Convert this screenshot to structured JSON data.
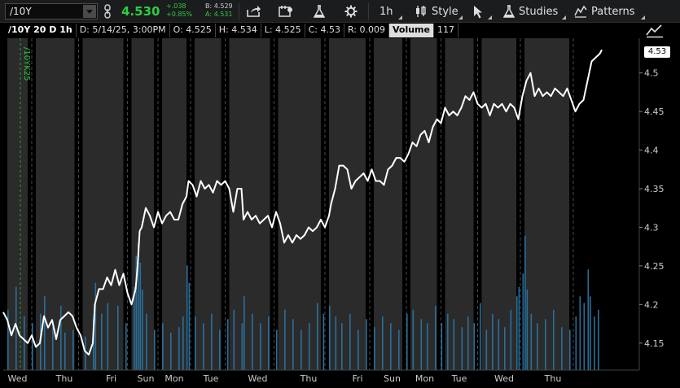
{
  "toolbar": {
    "symbol": "/10Y",
    "last_price": "4.530",
    "net_change": "+.038",
    "net_change_pct": "+0.85%",
    "bid": "B: 4.529",
    "ask": "A: 4.531",
    "timeframe": "1h",
    "style_label": "Style",
    "studies_label": "Studies",
    "patterns_label": "Patterns"
  },
  "info_bar": {
    "title": "/10Y 20 D 1h",
    "date": "D: 5/14/25, 3:00PM",
    "open": "O: 4.525",
    "high": "H: 4.534",
    "low": "L: 4.525",
    "close": "C: 4.53",
    "range": "R: 0.009",
    "volume_label": "Volume",
    "volume_value": "117"
  },
  "price_tag": "4.53",
  "contract_label": "/10YK25",
  "colors": {
    "line": "#ffffff",
    "volume": "#2a6f9a",
    "up": "#2ecc40",
    "session_bg": "#3a3a3a"
  },
  "chart_data": {
    "type": "line",
    "ylim": [
      4.115,
      4.545
    ],
    "y_ticks": [
      4.15,
      4.2,
      4.25,
      4.3,
      4.35,
      4.4,
      4.45,
      4.5
    ],
    "x_tick_labels": [
      "Wed",
      "Thu",
      "Fri",
      "Sun",
      "Mon",
      "Tue",
      "Wed",
      "Thu",
      "Fri",
      "Sun",
      "Mon",
      "Tue",
      "Wed",
      "Thu"
    ],
    "x_tick_positions": [
      7,
      30,
      53,
      70,
      84,
      102,
      125,
      150,
      174,
      191,
      207,
      224,
      246,
      270
    ],
    "bar_count": 285,
    "price": [
      [
        0,
        4.19
      ],
      [
        2,
        4.18
      ],
      [
        4,
        4.16
      ],
      [
        6,
        4.175
      ],
      [
        8,
        4.16
      ],
      [
        10,
        4.155
      ],
      [
        12,
        4.15
      ],
      [
        14,
        4.16
      ],
      [
        16,
        4.145
      ],
      [
        18,
        4.15
      ],
      [
        20,
        4.185
      ],
      [
        22,
        4.17
      ],
      [
        24,
        4.18
      ],
      [
        26,
        4.155
      ],
      [
        28,
        4.18
      ],
      [
        30,
        4.185
      ],
      [
        32,
        4.19
      ],
      [
        34,
        4.185
      ],
      [
        36,
        4.17
      ],
      [
        38,
        4.16
      ],
      [
        40,
        4.14
      ],
      [
        42,
        4.135
      ],
      [
        44,
        4.15
      ],
      [
        45,
        4.2
      ],
      [
        47,
        4.22
      ],
      [
        49,
        4.22
      ],
      [
        51,
        4.235
      ],
      [
        53,
        4.225
      ],
      [
        55,
        4.245
      ],
      [
        57,
        4.225
      ],
      [
        59,
        4.24
      ],
      [
        61,
        4.215
      ],
      [
        63,
        4.2
      ],
      [
        65,
        4.22
      ],
      [
        66,
        4.25
      ],
      [
        67,
        4.295
      ],
      [
        68,
        4.3
      ],
      [
        70,
        4.325
      ],
      [
        72,
        4.315
      ],
      [
        74,
        4.3
      ],
      [
        76,
        4.32
      ],
      [
        78,
        4.305
      ],
      [
        80,
        4.315
      ],
      [
        82,
        4.32
      ],
      [
        84,
        4.31
      ],
      [
        86,
        4.31
      ],
      [
        88,
        4.33
      ],
      [
        90,
        4.34
      ],
      [
        91,
        4.36
      ],
      [
        93,
        4.355
      ],
      [
        95,
        4.34
      ],
      [
        97,
        4.36
      ],
      [
        99,
        4.35
      ],
      [
        101,
        4.355
      ],
      [
        103,
        4.345
      ],
      [
        105,
        4.36
      ],
      [
        107,
        4.355
      ],
      [
        109,
        4.36
      ],
      [
        111,
        4.35
      ],
      [
        113,
        4.32
      ],
      [
        115,
        4.35
      ],
      [
        117,
        4.35
      ],
      [
        118,
        4.31
      ],
      [
        120,
        4.32
      ],
      [
        122,
        4.31
      ],
      [
        124,
        4.315
      ],
      [
        126,
        4.305
      ],
      [
        128,
        4.31
      ],
      [
        130,
        4.315
      ],
      [
        132,
        4.3
      ],
      [
        134,
        4.32
      ],
      [
        136,
        4.305
      ],
      [
        138,
        4.28
      ],
      [
        140,
        4.29
      ],
      [
        142,
        4.28
      ],
      [
        144,
        4.29
      ],
      [
        146,
        4.285
      ],
      [
        148,
        4.29
      ],
      [
        150,
        4.3
      ],
      [
        152,
        4.295
      ],
      [
        154,
        4.3
      ],
      [
        156,
        4.31
      ],
      [
        158,
        4.3
      ],
      [
        160,
        4.315
      ],
      [
        161,
        4.33
      ],
      [
        163,
        4.35
      ],
      [
        165,
        4.38
      ],
      [
        167,
        4.38
      ],
      [
        169,
        4.375
      ],
      [
        171,
        4.35
      ],
      [
        173,
        4.36
      ],
      [
        175,
        4.365
      ],
      [
        177,
        4.37
      ],
      [
        179,
        4.36
      ],
      [
        181,
        4.375
      ],
      [
        183,
        4.36
      ],
      [
        185,
        4.36
      ],
      [
        187,
        4.355
      ],
      [
        189,
        4.375
      ],
      [
        191,
        4.38
      ],
      [
        193,
        4.39
      ],
      [
        195,
        4.39
      ],
      [
        197,
        4.385
      ],
      [
        199,
        4.395
      ],
      [
        201,
        4.41
      ],
      [
        203,
        4.405
      ],
      [
        205,
        4.42
      ],
      [
        207,
        4.425
      ],
      [
        209,
        4.41
      ],
      [
        211,
        4.43
      ],
      [
        213,
        4.44
      ],
      [
        215,
        4.435
      ],
      [
        217,
        4.455
      ],
      [
        219,
        4.445
      ],
      [
        221,
        4.45
      ],
      [
        223,
        4.445
      ],
      [
        225,
        4.455
      ],
      [
        227,
        4.47
      ],
      [
        229,
        4.465
      ],
      [
        231,
        4.475
      ],
      [
        233,
        4.46
      ],
      [
        235,
        4.455
      ],
      [
        237,
        4.46
      ],
      [
        239,
        4.445
      ],
      [
        241,
        4.46
      ],
      [
        243,
        4.455
      ],
      [
        245,
        4.46
      ],
      [
        247,
        4.45
      ],
      [
        249,
        4.46
      ],
      [
        251,
        4.455
      ],
      [
        253,
        4.44
      ],
      [
        255,
        4.47
      ],
      [
        257,
        4.49
      ],
      [
        259,
        4.5
      ],
      [
        261,
        4.47
      ],
      [
        263,
        4.48
      ],
      [
        265,
        4.47
      ],
      [
        267,
        4.475
      ],
      [
        269,
        4.47
      ],
      [
        271,
        4.48
      ],
      [
        273,
        4.475
      ],
      [
        275,
        4.47
      ],
      [
        277,
        4.48
      ],
      [
        279,
        4.465
      ],
      [
        281,
        4.45
      ],
      [
        283,
        4.46
      ],
      [
        285,
        4.465
      ],
      [
        287,
        4.49
      ],
      [
        289,
        4.515
      ],
      [
        291,
        4.52
      ],
      [
        293,
        4.525
      ],
      [
        294,
        4.53
      ]
    ],
    "volume": [
      [
        2,
        0.45
      ],
      [
        6,
        0.62
      ],
      [
        10,
        0.4
      ],
      [
        14,
        0.35
      ],
      [
        18,
        0.42
      ],
      [
        20,
        0.55
      ],
      [
        24,
        0.32
      ],
      [
        28,
        0.48
      ],
      [
        30,
        0.28
      ],
      [
        34,
        0.3
      ],
      [
        40,
        0.25
      ],
      [
        44,
        0.38
      ],
      [
        45,
        0.65
      ],
      [
        48,
        0.42
      ],
      [
        51,
        0.5
      ],
      [
        56,
        0.48
      ],
      [
        60,
        0.35
      ],
      [
        64,
        0.62
      ],
      [
        65,
        0.85
      ],
      [
        66,
        0.95
      ],
      [
        67,
        0.8
      ],
      [
        68,
        0.6
      ],
      [
        70,
        0.42
      ],
      [
        74,
        0.3
      ],
      [
        78,
        0.35
      ],
      [
        82,
        0.28
      ],
      [
        86,
        0.32
      ],
      [
        88,
        0.4
      ],
      [
        90,
        0.78
      ],
      [
        91,
        0.65
      ],
      [
        94,
        0.4
      ],
      [
        98,
        0.35
      ],
      [
        102,
        0.42
      ],
      [
        106,
        0.3
      ],
      [
        110,
        0.38
      ],
      [
        113,
        0.45
      ],
      [
        117,
        0.35
      ],
      [
        118,
        0.55
      ],
      [
        122,
        0.42
      ],
      [
        126,
        0.35
      ],
      [
        130,
        0.4
      ],
      [
        134,
        0.3
      ],
      [
        138,
        0.45
      ],
      [
        142,
        0.38
      ],
      [
        146,
        0.3
      ],
      [
        150,
        0.35
      ],
      [
        154,
        0.5
      ],
      [
        157,
        0.42
      ],
      [
        160,
        0.48
      ],
      [
        163,
        0.4
      ],
      [
        166,
        0.35
      ],
      [
        170,
        0.42
      ],
      [
        174,
        0.3
      ],
      [
        178,
        0.38
      ],
      [
        182,
        0.32
      ],
      [
        186,
        0.4
      ],
      [
        190,
        0.35
      ],
      [
        194,
        0.3
      ],
      [
        198,
        0.42
      ],
      [
        201,
        0.45
      ],
      [
        205,
        0.38
      ],
      [
        208,
        0.35
      ],
      [
        212,
        0.48
      ],
      [
        215,
        0.35
      ],
      [
        218,
        0.42
      ],
      [
        221,
        0.38
      ],
      [
        225,
        0.32
      ],
      [
        228,
        0.4
      ],
      [
        231,
        0.35
      ],
      [
        234,
        0.5
      ],
      [
        237,
        0.3
      ],
      [
        240,
        0.42
      ],
      [
        243,
        0.38
      ],
      [
        246,
        0.32
      ],
      [
        249,
        0.45
      ],
      [
        252,
        0.55
      ],
      [
        253,
        0.62
      ],
      [
        255,
        0.72
      ],
      [
        256,
        1.0
      ],
      [
        257,
        0.6
      ],
      [
        259,
        0.42
      ],
      [
        262,
        0.35
      ],
      [
        266,
        0.38
      ],
      [
        270,
        0.45
      ],
      [
        274,
        0.32
      ],
      [
        278,
        0.3
      ],
      [
        281,
        0.4
      ],
      [
        283,
        0.55
      ],
      [
        285,
        0.5
      ],
      [
        287,
        0.75
      ],
      [
        288,
        0.55
      ],
      [
        290,
        0.4
      ],
      [
        292,
        0.45
      ]
    ]
  }
}
